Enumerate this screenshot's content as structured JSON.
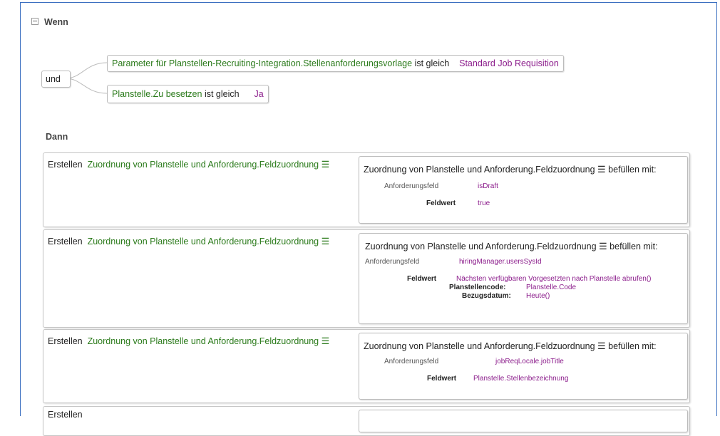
{
  "if_section": {
    "label": "Wenn"
  },
  "operator": "und",
  "conditions": [
    {
      "field": "Parameter für Planstellen-Recruiting-Integration.Stellenanforderungsvorlage",
      "op": "ist gleich",
      "value": "Standard Job Requisition"
    },
    {
      "field": "Planstelle.Zu besetzen",
      "op": "ist gleich",
      "value": "Ja"
    }
  ],
  "then_section": {
    "label": "Dann"
  },
  "actions": [
    {
      "verb": "Erstellen",
      "target": "Zuordnung von Planstelle und Anforderung.Feldzuordnung",
      "fill_title": "Zuordnung von Planstelle und Anforderung.Feldzuordnung",
      "fill_suffix": "befüllen mit:",
      "field_label": "Anforderungsfeld",
      "field_value": "isDraft",
      "value_label": "Feldwert",
      "value_value": "true"
    },
    {
      "verb": "Erstellen",
      "target": "Zuordnung von Planstelle und Anforderung.Feldzuordnung",
      "fill_title": "Zuordnung von Planstelle und Anforderung.Feldzuordnung",
      "fill_suffix": "befüllen mit:",
      "field_label": "Anforderungsfeld",
      "field_value": "hiringManager.usersSysId",
      "value_label": "Feldwert",
      "value_value": "Nächsten verfügbaren Vorgesetzten nach Planstelle abrufen()",
      "params": [
        {
          "label": "Planstellencode:",
          "value": "Planstelle.Code"
        },
        {
          "label": "Bezugsdatum:",
          "value": "Heute()"
        }
      ]
    },
    {
      "verb": "Erstellen",
      "target": "Zuordnung von Planstelle und Anforderung.Feldzuordnung",
      "fill_title": "Zuordnung von Planstelle und Anforderung.Feldzuordnung",
      "fill_suffix": "befüllen mit:",
      "field_label": "Anforderungsfeld",
      "field_value": "jobReqLocale.jobTitle",
      "value_label": "Feldwert",
      "value_value": "Planstelle.Stellenbezeichnung"
    },
    {
      "verb": "Erstellen"
    }
  ],
  "icons": {
    "menu": "hamburger-menu-icon",
    "collapse": "collapse-minus-icon"
  },
  "colors": {
    "field": "#2a7a1a",
    "value": "#8b1c8b",
    "frame": "#3b6fc0"
  }
}
